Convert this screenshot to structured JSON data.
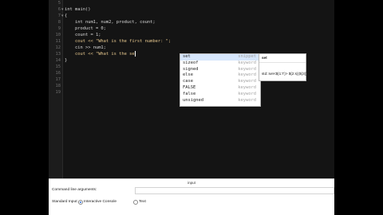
{
  "editor": {
    "line_numbers": [
      "5",
      "6",
      "7",
      "8",
      "9",
      "10",
      "11",
      "12",
      "13",
      "14",
      "15",
      "16",
      "17",
      "18",
      "19"
    ],
    "lines": [
      "",
      "int main()",
      "{",
      "    int num1, num2, product, count;",
      "    product = 0;",
      "    count = 1;",
      "    cout << \"What is the first number: \";",
      "    cin >> num1;",
      "    cout << \"What is the se",
      "}",
      "",
      "",
      "",
      "",
      ""
    ],
    "fold_markers": [
      "▾",
      "▾"
    ]
  },
  "autocomplete": {
    "items": [
      {
        "word": "set",
        "kind": "snippet"
      },
      {
        "word": "sizeof",
        "kind": "keyword"
      },
      {
        "word": "signed",
        "kind": "keyword"
      },
      {
        "word": "else",
        "kind": "keyword"
      },
      {
        "word": "case",
        "kind": "keyword"
      },
      {
        "word": "FALSE",
        "kind": "keyword"
      },
      {
        "word": "false",
        "kind": "keyword"
      },
      {
        "word": "unsigned",
        "kind": "keyword"
      }
    ],
    "doc": {
      "title": "set",
      "signature": "std::set<${1:T}> ${2:s}(${3});"
    }
  },
  "io_panel": {
    "title": "input",
    "command_line_label": "Command line arguments:",
    "command_line_value": "",
    "standard_input_label": "Standard Input:",
    "option_interactive": "Interactive Console",
    "option_text": "Text"
  },
  "colors": {
    "editor_bg": "#141414",
    "selection": "#d6e6fb",
    "radio_accent": "#2f6fd6"
  }
}
